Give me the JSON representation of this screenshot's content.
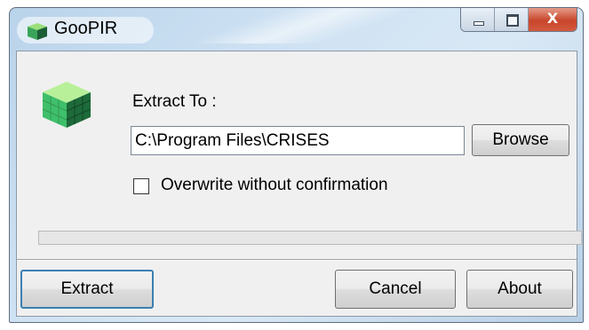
{
  "window": {
    "title": "GooPIR",
    "close_glyph": "X",
    "icon": "goopir-cube-icon"
  },
  "form": {
    "extract_to_label": "Extract To :",
    "path_value": "C:\\Program Files\\CRISES",
    "browse_label": "Browse",
    "overwrite_label": "Overwrite without confirmation",
    "overwrite_checked": false,
    "progress_fraction": 0
  },
  "buttons": {
    "extract_label": "Extract",
    "cancel_label": "Cancel",
    "about_label": "About"
  },
  "colors": {
    "accent_focus": "#3c7fb1",
    "close_button": "#c9452b",
    "progress_fill": "#06b025"
  }
}
